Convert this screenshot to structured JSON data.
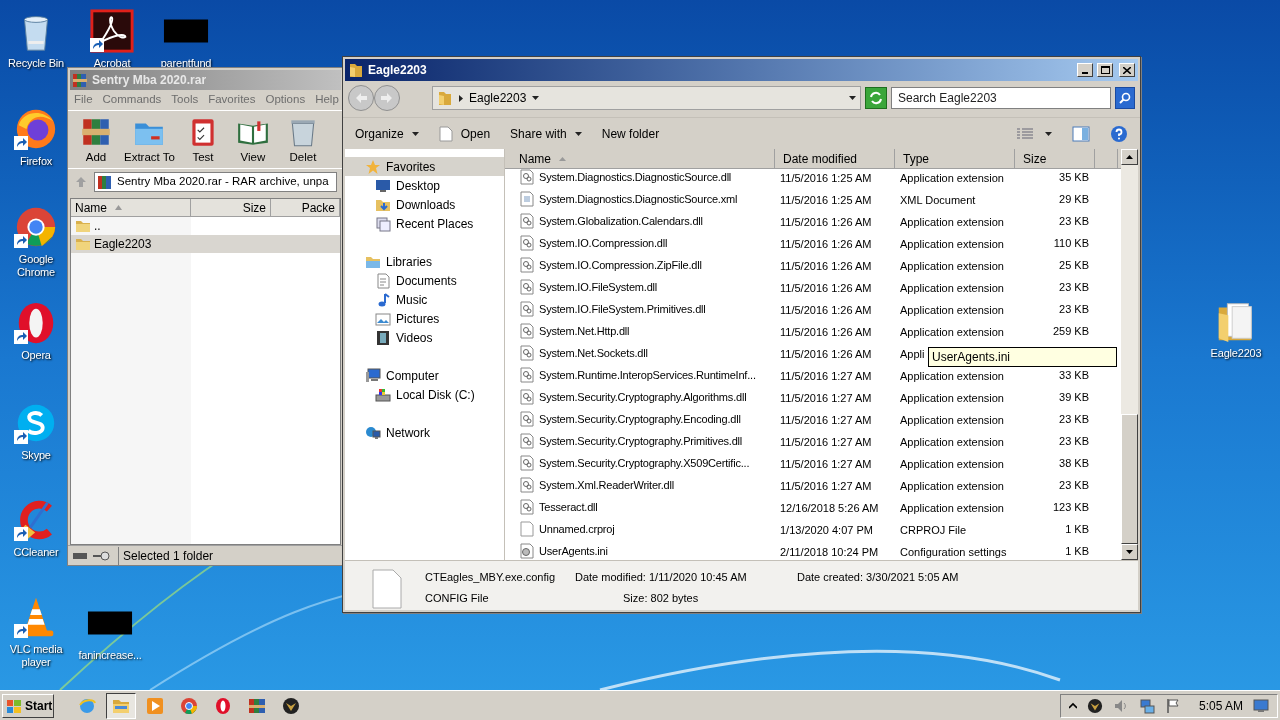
{
  "desktop_icons": [
    {
      "label": "Recycle Bin",
      "kind": "recycle_bin",
      "shortcut": false
    },
    {
      "label": "Acrobat",
      "kind": "acrobat",
      "shortcut": true
    },
    {
      "label": "parentfund",
      "kind": "redacted",
      "shortcut": false
    },
    {
      "label": "Firefox",
      "kind": "firefox",
      "shortcut": true
    },
    {
      "label": "Google Chrome",
      "kind": "chrome",
      "shortcut": true
    },
    {
      "label": "Opera",
      "kind": "opera",
      "shortcut": true
    },
    {
      "label": "Skype",
      "kind": "skype",
      "shortcut": true
    },
    {
      "label": "CCleaner",
      "kind": "ccleaner",
      "shortcut": true
    },
    {
      "label": "VLC media player",
      "kind": "vlc",
      "shortcut": true
    },
    {
      "label": "fanincrease...",
      "kind": "redacted",
      "shortcut": false
    },
    {
      "label": "Eagle2203",
      "kind": "folder",
      "shortcut": false
    }
  ],
  "winrar": {
    "title": "Sentry Mba 2020.rar",
    "menu": [
      "File",
      "Commands",
      "Tools",
      "Favorites",
      "Options",
      "Help"
    ],
    "tools": [
      {
        "label": "Add",
        "kind": "add"
      },
      {
        "label": "Extract To",
        "kind": "extract"
      },
      {
        "label": "Test",
        "kind": "test"
      },
      {
        "label": "View",
        "kind": "view"
      },
      {
        "label": "Delet",
        "kind": "delete"
      }
    ],
    "address": "Sentry Mba 2020.rar - RAR archive, unpa",
    "columns": [
      {
        "label": "Name",
        "sorted": true
      },
      {
        "label": "Size",
        "sorted": false
      },
      {
        "label": "Packe",
        "sorted": false
      }
    ],
    "rows": [
      {
        "name": "..",
        "selected": false
      },
      {
        "name": "Eagle2203",
        "selected": true
      }
    ],
    "status": "Selected 1 folder"
  },
  "explorer": {
    "title": "Eagle2203",
    "address": "Eagle2203",
    "search": {
      "placeholder": "Search Eagle2203"
    },
    "commands": [
      {
        "label": "Organize",
        "kind": "menu"
      },
      {
        "label": "Open",
        "kind": "open"
      },
      {
        "label": "Share with",
        "kind": "menu"
      },
      {
        "label": "New folder",
        "kind": "plain"
      }
    ],
    "nav": [
      {
        "label": "Favorites",
        "kind": "star",
        "selected": true,
        "children": [
          {
            "label": "Desktop",
            "kind": "desktop",
            "selected": false
          },
          {
            "label": "Downloads",
            "kind": "downloads",
            "selected": false
          },
          {
            "label": "Recent Places",
            "kind": "recent",
            "selected": false
          }
        ]
      },
      {
        "label": "Libraries",
        "kind": "libraries",
        "selected": false,
        "children": [
          {
            "label": "Documents",
            "kind": "documents",
            "selected": false
          },
          {
            "label": "Music",
            "kind": "music",
            "selected": false
          },
          {
            "label": "Pictures",
            "kind": "pictures",
            "selected": false
          },
          {
            "label": "Videos",
            "kind": "videos",
            "selected": false
          }
        ]
      },
      {
        "label": "Computer",
        "kind": "computer",
        "selected": false,
        "children": [
          {
            "label": "Local Disk (C:)",
            "kind": "disk",
            "selected": false
          }
        ]
      },
      {
        "label": "Network",
        "kind": "network",
        "selected": false
      }
    ],
    "columns": [
      {
        "label": "Name",
        "sorted": true
      },
      {
        "label": "Date modified",
        "sorted": false
      },
      {
        "label": "Type",
        "sorted": false
      },
      {
        "label": "Size",
        "sorted": false
      }
    ],
    "files": [
      {
        "name": "System.Diagnostics.DiagnosticSource.dll",
        "date": "11/5/2016 1:25 AM",
        "type": "Application extension",
        "size": "35 KB",
        "kind": "dll"
      },
      {
        "name": "System.Diagnostics.DiagnosticSource.xml",
        "date": "11/5/2016 1:25 AM",
        "type": "XML Document",
        "size": "29 KB",
        "kind": "xml"
      },
      {
        "name": "System.Globalization.Calendars.dll",
        "date": "11/5/2016 1:26 AM",
        "type": "Application extension",
        "size": "23 KB",
        "kind": "dll"
      },
      {
        "name": "System.IO.Compression.dll",
        "date": "11/5/2016 1:26 AM",
        "type": "Application extension",
        "size": "110 KB",
        "kind": "dll"
      },
      {
        "name": "System.IO.Compression.ZipFile.dll",
        "date": "11/5/2016 1:26 AM",
        "type": "Application extension",
        "size": "25 KB",
        "kind": "dll"
      },
      {
        "name": "System.IO.FileSystem.dll",
        "date": "11/5/2016 1:26 AM",
        "type": "Application extension",
        "size": "23 KB",
        "kind": "dll"
      },
      {
        "name": "System.IO.FileSystem.Primitives.dll",
        "date": "11/5/2016 1:26 AM",
        "type": "Application extension",
        "size": "23 KB",
        "kind": "dll"
      },
      {
        "name": "System.Net.Http.dll",
        "date": "11/5/2016 1:26 AM",
        "type": "Application extension",
        "size": "259 KB",
        "kind": "dll"
      },
      {
        "name": "System.Net.Sockets.dll",
        "date": "11/5/2016 1:26 AM",
        "type": "Appli",
        "kind": "dll"
      },
      {
        "name": "System.Runtime.InteropServices.RuntimeInf...",
        "date": "11/5/2016 1:27 AM",
        "type": "Application extension",
        "size": "33 KB",
        "kind": "dll"
      },
      {
        "name": "System.Security.Cryptography.Algorithms.dll",
        "date": "11/5/2016 1:27 AM",
        "type": "Application extension",
        "size": "39 KB",
        "kind": "dll"
      },
      {
        "name": "System.Security.Cryptography.Encoding.dll",
        "date": "11/5/2016 1:27 AM",
        "type": "Application extension",
        "size": "23 KB",
        "kind": "dll"
      },
      {
        "name": "System.Security.Cryptography.Primitives.dll",
        "date": "11/5/2016 1:27 AM",
        "type": "Application extension",
        "size": "23 KB",
        "kind": "dll"
      },
      {
        "name": "System.Security.Cryptography.X509Certific...",
        "date": "11/5/2016 1:27 AM",
        "type": "Application extension",
        "size": "38 KB",
        "kind": "dll"
      },
      {
        "name": "System.Xml.ReaderWriter.dll",
        "date": "11/5/2016 1:27 AM",
        "type": "Application extension",
        "size": "23 KB",
        "kind": "dll"
      },
      {
        "name": "Tesseract.dll",
        "date": "12/16/2018 5:26 AM",
        "type": "Application extension",
        "size": "123 KB",
        "kind": "dll"
      },
      {
        "name": "Unnamed.crproj",
        "date": "1/13/2020 4:07 PM",
        "type": "CRPROJ File",
        "size": "1 KB",
        "kind": "blank"
      },
      {
        "name": "UserAgents.ini",
        "date": "2/11/2018 10:24 PM",
        "type": "Configuration settings",
        "size": "1 KB",
        "kind": "ini"
      }
    ],
    "tooltip": "UserAgents.ini",
    "details": {
      "name": "CTEagles_MBY.exe.config",
      "type": "CONFIG File",
      "modified": "Date modified: 1/11/2020 10:45 AM",
      "size": "Size: 802 bytes",
      "created": "Date created: 3/30/2021 5:05 AM"
    }
  },
  "taskbar": {
    "start": "Start",
    "apps": [
      {
        "kind": "ie",
        "active": false
      },
      {
        "kind": "explorer",
        "active": true
      },
      {
        "kind": "media",
        "active": false
      },
      {
        "kind": "chrome",
        "active": false
      },
      {
        "kind": "opera",
        "active": false
      },
      {
        "kind": "winrar",
        "active": false
      },
      {
        "kind": "emblem",
        "active": false
      }
    ],
    "clock": "5:05 AM"
  }
}
